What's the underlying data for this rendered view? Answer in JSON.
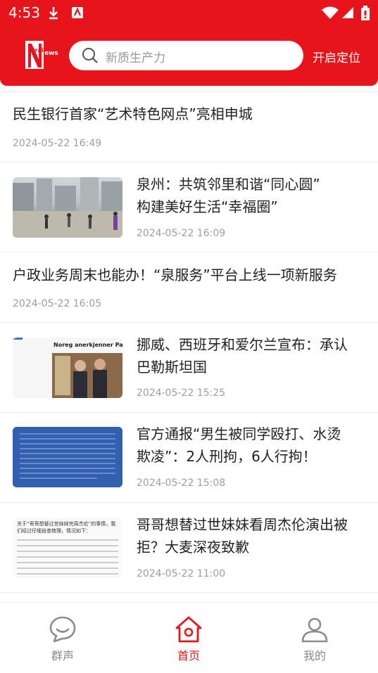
{
  "status_bar": {
    "time": "4:53",
    "icons": [
      "download-icon",
      "app-notify-icon",
      "wifi-icon",
      "signal-icon",
      "battery-icon"
    ]
  },
  "header": {
    "logo_text": "StraitNews",
    "search_placeholder": "新质生产力",
    "locate_label": "开启定位",
    "brand_color": "#e8141b"
  },
  "news": [
    {
      "title_lines": [
        "民生银行首家“艺术特色网点”亮相申城"
      ],
      "date": "2024-05-22 16:49",
      "thumbnail": false
    },
    {
      "title_lines": [
        "泉州：共筑邻里和谐“同心圆”",
        "构建美好生活“幸福圈”"
      ],
      "date": "2024-05-22 16:09",
      "thumbnail": true,
      "thumbnail_desc": "photo"
    },
    {
      "title_lines": [
        "户政业务周末也能办！“泉服务”平台上线一项新服务"
      ],
      "date": "2024-05-22 16:05",
      "thumbnail": false
    },
    {
      "title_lines": [
        "挪威、西班牙和爱尔兰宣布：承认",
        "巴勒斯坦国"
      ],
      "date": "2024-05-22 15:25",
      "thumbnail": true,
      "thumbnail_caption": "Noreg anerkjenner Palestina"
    },
    {
      "title_lines": [
        "官方通报“男生被同学殴打、水烫",
        "欺凌”：2人刑拘，6人行拘！"
      ],
      "date": "2024-05-22 15:08",
      "thumbnail": true,
      "thumbnail_desc": "notice"
    },
    {
      "title_lines": [
        "哥哥想替过世妹妹看周杰伦演出被",
        "拒？大麦深夜致歉"
      ],
      "date": "2024-05-22 11:00",
      "thumbnail": true,
      "thumbnail_caption": "关于“哥哥想替过世妹妹完周杰伦”的事情，我们经过仔细自查梳理，情况如下："
    }
  ],
  "bottom_nav": {
    "items": [
      {
        "label": "群声",
        "icon": "chat-bubble-icon",
        "active": false
      },
      {
        "label": "首页",
        "icon": "home-icon",
        "active": true
      },
      {
        "label": "我的",
        "icon": "user-icon",
        "active": false
      }
    ],
    "active_color": "#e8141b",
    "inactive_color": "#888888"
  }
}
